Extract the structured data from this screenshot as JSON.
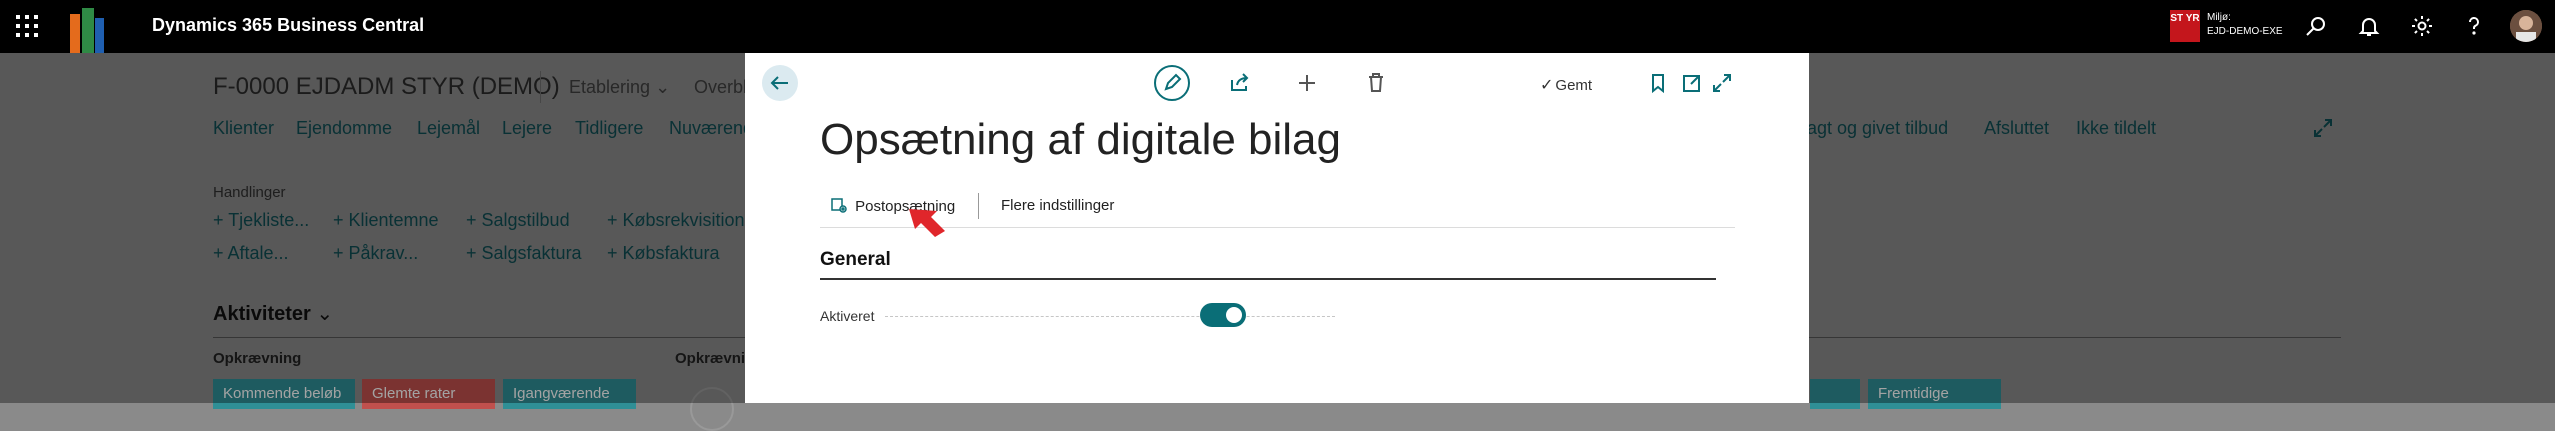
{
  "topbar": {
    "app_title": "Dynamics 365 Business Central",
    "env_badge": "ST YR",
    "env_label": "Miljø:",
    "env_name": "EJD-DEMO-EXE",
    "icons": [
      "waffle-icon",
      "search-icon",
      "bell-icon",
      "gear-icon",
      "help-icon",
      "avatar"
    ]
  },
  "background": {
    "page_title": "F-0000 EJDADM STYR (DEMO)",
    "menu": [
      "Etablering",
      "Overbl"
    ],
    "nav": [
      "Klienter",
      "Ejendomme",
      "Lejemål",
      "Lejere",
      "Tidligere",
      "Nuværend",
      "lagt og givet tilbud",
      "Afsluttet",
      "Ikke tildelt"
    ],
    "actions_label": "Handlinger",
    "actions_row1": [
      "Tjekliste...",
      "Klientemne",
      "Salgstilbud",
      "Købsrekvisition"
    ],
    "actions_row2": [
      "Aftale...",
      "Påkrav...",
      "Salgsfaktura",
      "Købsfaktura"
    ],
    "activities_label": "Aktiviteter",
    "group1_label": "Opkrævning",
    "group2_label": "Opkrævni",
    "tiles": [
      "Kommende beløb",
      "Glemte rater",
      "Igangværende",
      "Fremtidige"
    ]
  },
  "modal": {
    "title": "Opsætning af digitale bilag",
    "saved_label": "Gemt",
    "tabs": [
      "Postopsætning",
      "Flere indstillinger"
    ],
    "section_title": "General",
    "field_label": "Aktiveret",
    "field_value": true
  },
  "colors": {
    "accent": "#0a6e77",
    "env_badge": "#c4161c",
    "tile_teal": "#2f8f96",
    "tile_red": "#c0504d"
  }
}
